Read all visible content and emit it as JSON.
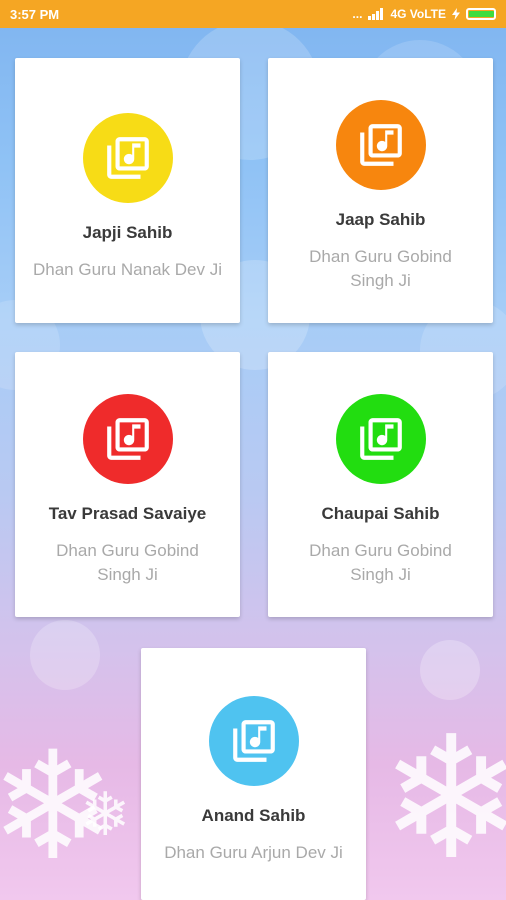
{
  "status_bar": {
    "time": "3:57 PM",
    "dots": "...",
    "network": "4G VoLTE",
    "battery_level": 0.95
  },
  "colors": {
    "status_bar": "#f5a623",
    "japji": "#f7dc16",
    "jaap": "#f7860e",
    "tav": "#ef2b2b",
    "chaupai": "#22dd10",
    "anand": "#4fc3f0"
  },
  "cards": [
    {
      "title": "Japji Sahib",
      "subtitle": "Dhan Guru Nanak Dev Ji",
      "icon": "music-library-icon"
    },
    {
      "title": "Jaap Sahib",
      "subtitle": "Dhan Guru Gobind Singh Ji",
      "icon": "music-library-icon"
    },
    {
      "title": "Tav Prasad Savaiye",
      "subtitle": "Dhan Guru Gobind Singh Ji",
      "icon": "music-library-icon"
    },
    {
      "title": "Chaupai Sahib",
      "subtitle": "Dhan Guru Gobind Singh Ji",
      "icon": "music-library-icon"
    },
    {
      "title": "Anand Sahib",
      "subtitle": "Dhan Guru Arjun Dev Ji",
      "icon": "music-library-icon"
    }
  ]
}
